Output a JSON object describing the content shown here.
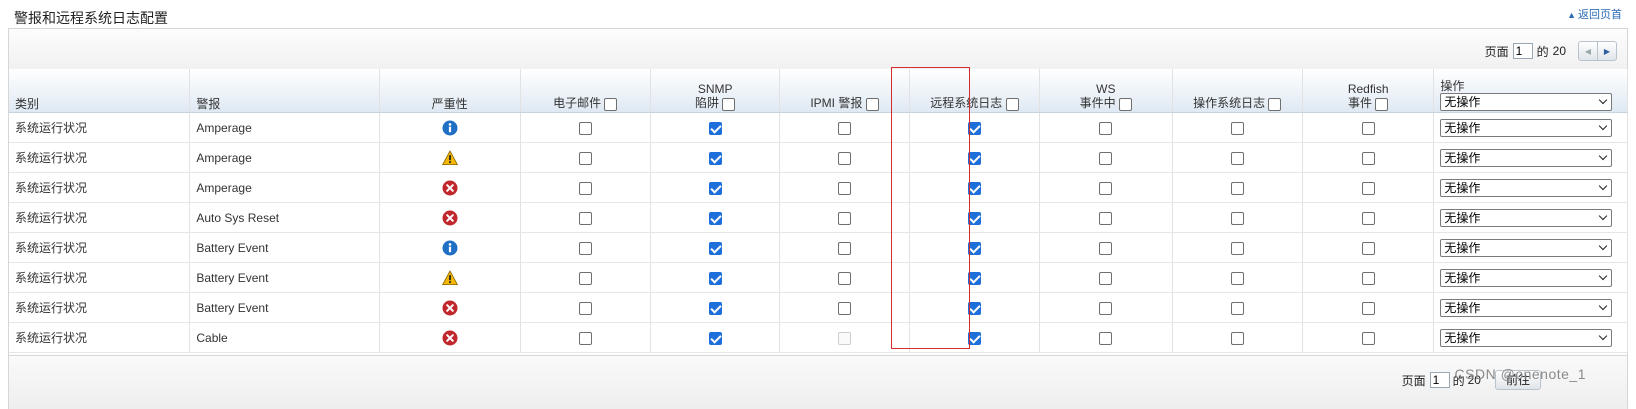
{
  "page_title": "警报和远程系统日志配置",
  "top_link": "返回页首",
  "pager": {
    "page_label": "页面",
    "current_page": "1",
    "of_label": "的",
    "total_pages": "20"
  },
  "columns": {
    "category": "类别",
    "alert": "警报",
    "severity": "严重性",
    "email": "电子邮件",
    "snmp_line1": "SNMP",
    "snmp_line2": "陷阱",
    "ipmi": "IPMI 警报",
    "remote_syslog": "远程系统日志",
    "ws_line1": "WS",
    "ws_line2": "事件中",
    "os_log": "操作系统日志",
    "redfish_line1": "Redfish",
    "redfish_line2": "事件",
    "action": "操作"
  },
  "header_action_value": "无操作",
  "rows": [
    {
      "category": "系统运行状况",
      "alert": "Amperage",
      "severity": "info",
      "email": false,
      "snmp": true,
      "ipmi": false,
      "ipmi_disabled": false,
      "remote": true,
      "ws": false,
      "os": false,
      "redfish": false,
      "action": "无操作"
    },
    {
      "category": "系统运行状况",
      "alert": "Amperage",
      "severity": "warning",
      "email": false,
      "snmp": true,
      "ipmi": false,
      "ipmi_disabled": false,
      "remote": true,
      "ws": false,
      "os": false,
      "redfish": false,
      "action": "无操作"
    },
    {
      "category": "系统运行状况",
      "alert": "Amperage",
      "severity": "critical",
      "email": false,
      "snmp": true,
      "ipmi": false,
      "ipmi_disabled": false,
      "remote": true,
      "ws": false,
      "os": false,
      "redfish": false,
      "action": "无操作"
    },
    {
      "category": "系统运行状况",
      "alert": "Auto Sys Reset",
      "severity": "critical",
      "email": false,
      "snmp": true,
      "ipmi": false,
      "ipmi_disabled": false,
      "remote": true,
      "ws": false,
      "os": false,
      "redfish": false,
      "action": "无操作"
    },
    {
      "category": "系统运行状况",
      "alert": "Battery Event",
      "severity": "info",
      "email": false,
      "snmp": true,
      "ipmi": false,
      "ipmi_disabled": false,
      "remote": true,
      "ws": false,
      "os": false,
      "redfish": false,
      "action": "无操作"
    },
    {
      "category": "系统运行状况",
      "alert": "Battery Event",
      "severity": "warning",
      "email": false,
      "snmp": true,
      "ipmi": false,
      "ipmi_disabled": false,
      "remote": true,
      "ws": false,
      "os": false,
      "redfish": false,
      "action": "无操作"
    },
    {
      "category": "系统运行状况",
      "alert": "Battery Event",
      "severity": "critical",
      "email": false,
      "snmp": true,
      "ipmi": false,
      "ipmi_disabled": false,
      "remote": true,
      "ws": false,
      "os": false,
      "redfish": false,
      "action": "无操作"
    },
    {
      "category": "系统运行状况",
      "alert": "Cable",
      "severity": "critical",
      "email": false,
      "snmp": true,
      "ipmi": false,
      "ipmi_disabled": true,
      "remote": true,
      "ws": false,
      "os": false,
      "redfish": false,
      "action": "无操作"
    }
  ],
  "footer_pager": {
    "page_label": "页面",
    "current_page": "1",
    "of_label": "的",
    "total_pages": "20",
    "go_label": "前往"
  },
  "watermark": "CSDN @onenote_1",
  "colors": {
    "checked": "#1e6fd9",
    "highlight": "#d42c2c",
    "info": "#1f6fc4",
    "warning": "#f2b705",
    "critical": "#c0282d"
  }
}
